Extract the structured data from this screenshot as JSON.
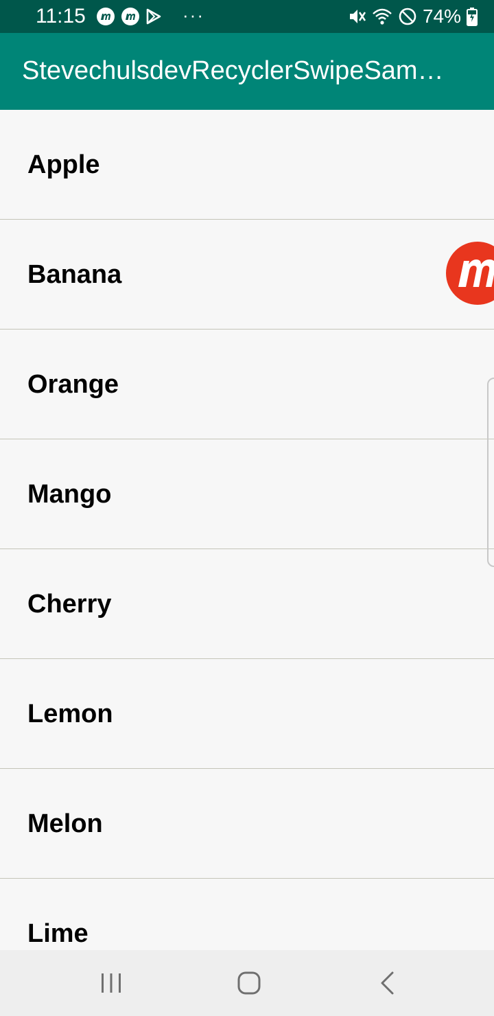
{
  "status_bar": {
    "time": "11:15",
    "left_icons": [
      "mobizen-icon",
      "mobizen-icon",
      "play-store-icon"
    ],
    "more_notifications": "···",
    "right_icons": [
      "mute-icon",
      "wifi-icon",
      "do-not-disturb-icon"
    ],
    "battery_percent": "74%",
    "battery_icon": "battery-charging-icon"
  },
  "app_bar": {
    "title": "StevechulsdevRecyclerSwipeSam…",
    "color": "#008577"
  },
  "list": {
    "items": [
      {
        "label": "Apple"
      },
      {
        "label": "Banana"
      },
      {
        "label": "Orange"
      },
      {
        "label": "Mango"
      },
      {
        "label": "Cherry"
      },
      {
        "label": "Lemon"
      },
      {
        "label": "Melon"
      },
      {
        "label": "Lime"
      }
    ]
  },
  "floating_bubble": {
    "icon": "mobizen-icon",
    "color": "#e8361e"
  },
  "nav_bar": {
    "recents_icon": "recents-icon",
    "home_icon": "home-icon",
    "back_icon": "back-icon"
  },
  "colors": {
    "status_bar": "#00574b",
    "app_bar": "#008577",
    "list_background": "#f7f7f7",
    "divider": "#c4c4b8"
  }
}
